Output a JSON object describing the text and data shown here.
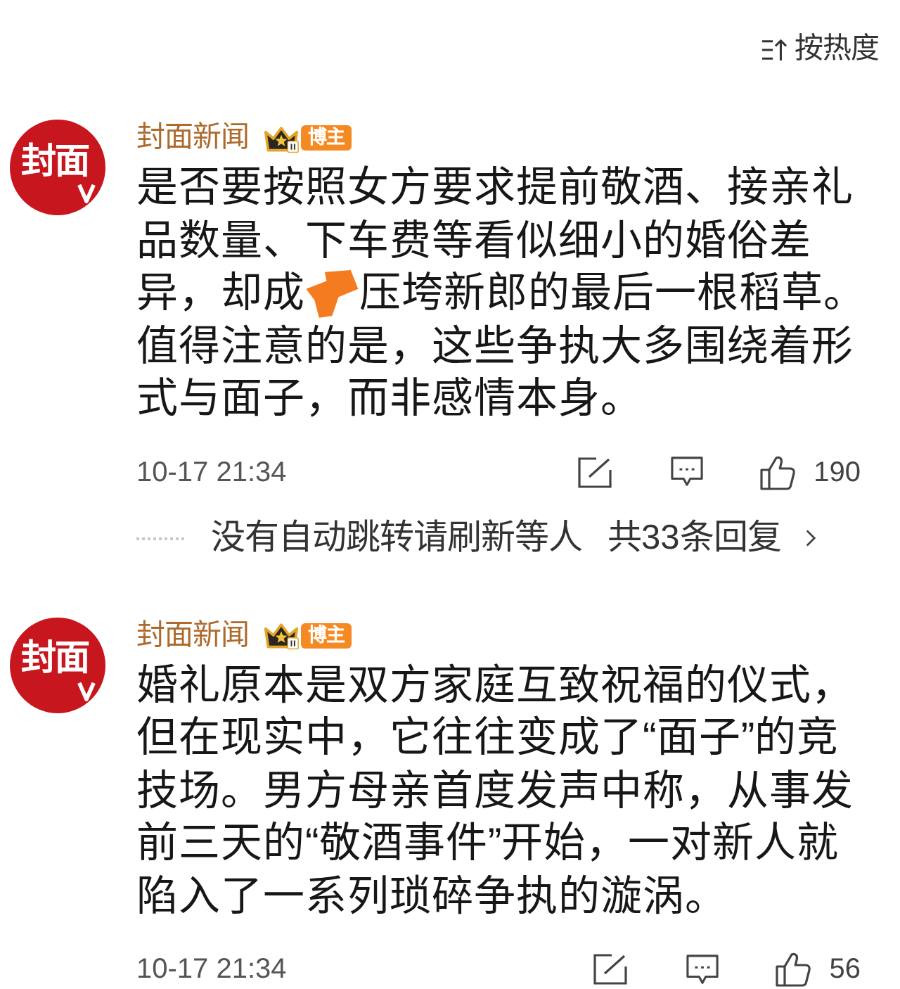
{
  "sort": {
    "label": "按热度"
  },
  "comments": [
    {
      "avatar_text": "封面",
      "verified": true,
      "author": "封面新闻",
      "role": "博主",
      "body": [
        {
          "kind": "text",
          "text": "是否要按照女方要求提前敬酒、接亲礼品数量、下车费等看似细小的婚俗差"
        },
        {
          "kind": "row",
          "parts": [
            {
              "kind": "text",
              "text": "异，却成"
            },
            {
              "kind": "sticker"
            },
            {
              "kind": "text",
              "text": "压垮新郎的最后一根稻草。"
            }
          ]
        },
        {
          "kind": "text",
          "text": "值得注意的是，这些争执大多围绕着形式与面子，而非感情本身。"
        }
      ],
      "time": "10-17 21:34",
      "likes": "190",
      "replies": {
        "users": "没有自动跳转请刷新等人",
        "total": "共33条回复"
      }
    },
    {
      "avatar_text": "封面",
      "verified": true,
      "author": "封面新闻",
      "role": "博主",
      "body": [
        {
          "kind": "text",
          "text": "婚礼原本是双方家庭互致祝福的仪式，但在现实中，它往往变成了“面子”的竞技场。男方母亲首度发声中称，从事发前三天的“敬酒事件”开始，一对新人就陷入了一系列琐碎争执的漩涡。"
        }
      ],
      "time": "10-17 21:34",
      "likes": "56"
    }
  ]
}
